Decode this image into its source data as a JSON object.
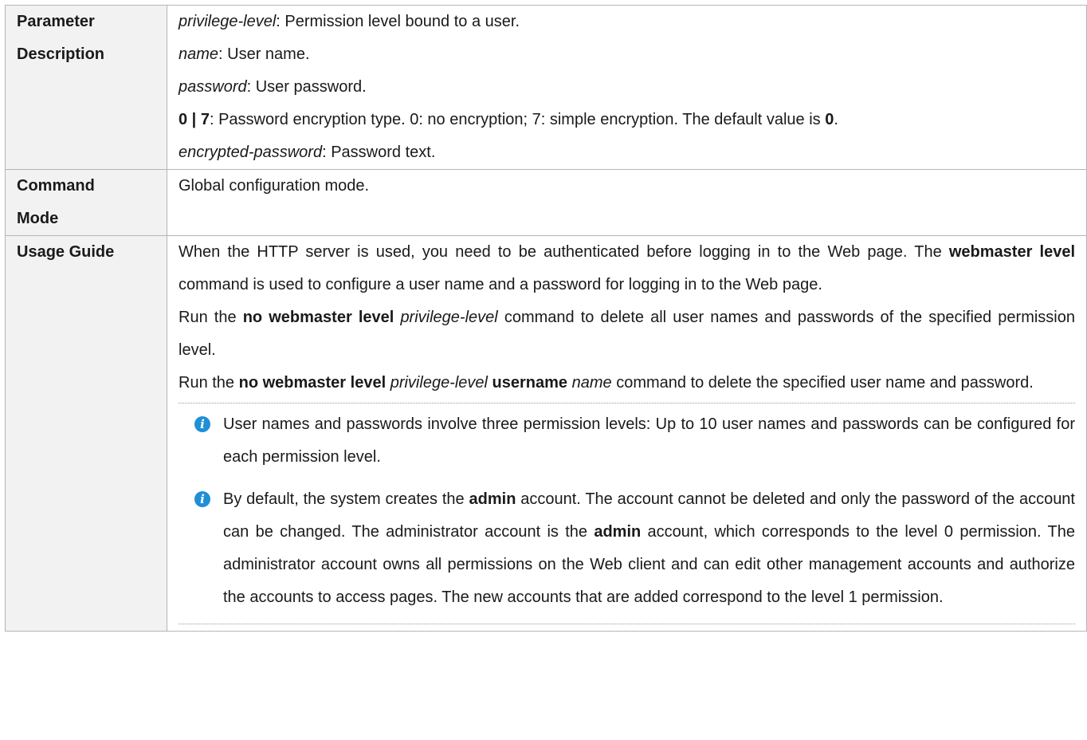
{
  "rows": {
    "param": {
      "label": [
        "Parameter",
        "Description"
      ],
      "l1_term": "privilege-level",
      "l1_text": ": Permission level bound to a user.",
      "l2_term": "name",
      "l2_text": ": User name.",
      "l3_term": "password",
      "l3_text": ": User password.",
      "l4_term": "0 | 7",
      "l4_text": ": Password encryption type. 0: no encryption; 7: simple encryption. The default value is ",
      "l4_default": "0",
      "l4_end": ".",
      "l5_term": "encrypted-password",
      "l5_text": ": Password text."
    },
    "mode": {
      "label": [
        "Command",
        "Mode"
      ],
      "text": "Global configuration mode."
    },
    "usage": {
      "label": "Usage Guide",
      "p1_a": "When the HTTP server is used, you need to be authenticated before logging in to the Web page. The ",
      "p1_cmd": "webmaster level",
      "p1_b": " command is used to configure a user name and a password for logging in to the Web page.",
      "p2_a": "Run the ",
      "p2_cmd": "no webmaster level",
      "p2_arg": "privilege-level",
      "p2_b": " command to delete all user names and passwords of the specified permission level.",
      "p3_a": "Run the ",
      "p3_cmd": "no webmaster level",
      "p3_arg": "privilege-level",
      "p3_kw": "username",
      "p3_arg2": "name",
      "p3_b": " command to delete the specified user name and password.",
      "note1": "User names and passwords involve three permission levels: Up to 10 user names and passwords can be configured for each permission level.",
      "note2_a": "By default, the system creates the ",
      "note2_acct1": "admin",
      "note2_b": " account. The account cannot be deleted and only the password of the account can be changed. The administrator account is the ",
      "note2_acct2": "admin",
      "note2_c": " account, which corresponds to the level 0 permission. The administrator account owns all permissions on the Web client and can edit other management accounts and authorize the accounts to access pages. The new accounts that are added correspond to the level 1 permission.",
      "note_icon": "info-icon"
    }
  }
}
